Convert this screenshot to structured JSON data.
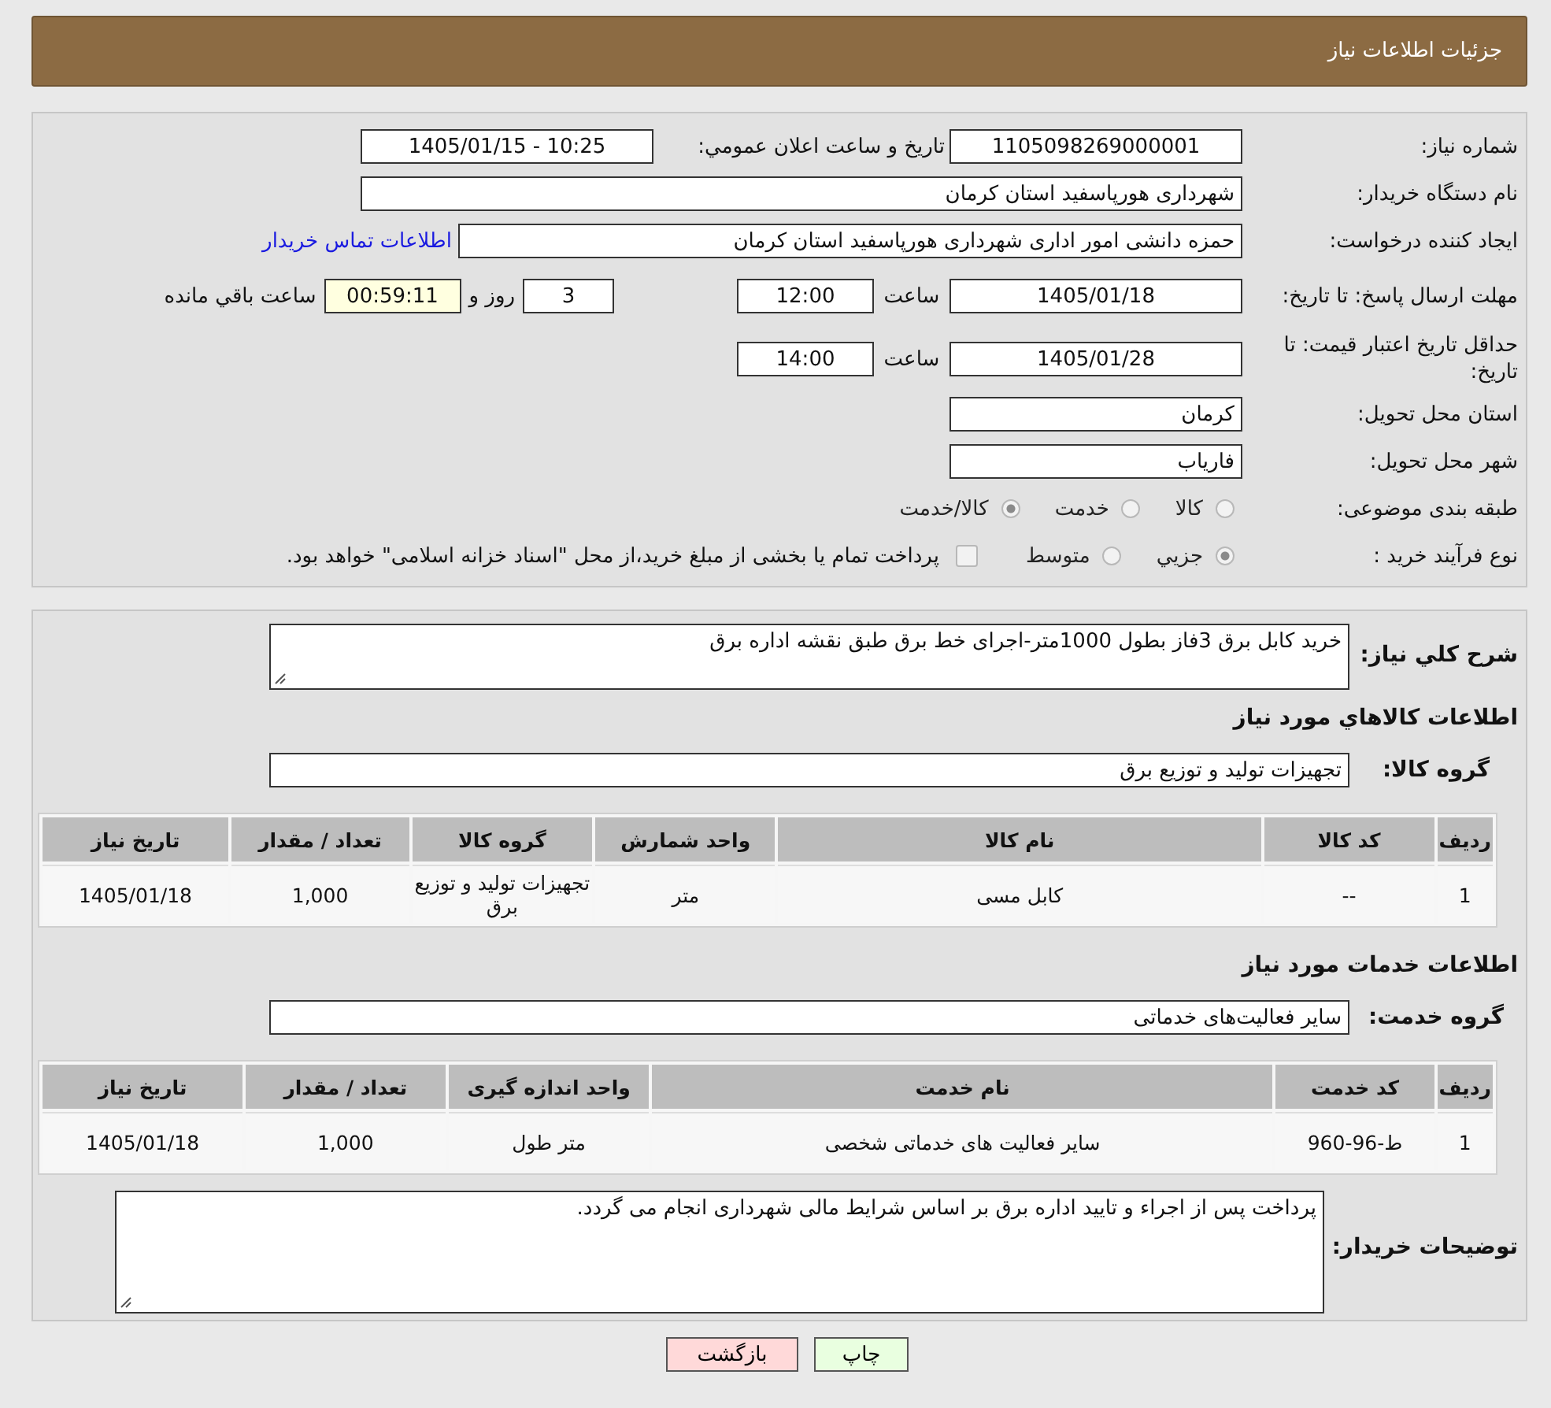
{
  "header": {
    "title": "جزئیات اطلاعات نیاز"
  },
  "details": {
    "need_number": {
      "label": "شماره نیاز:",
      "value": "1105098269000001"
    },
    "announce": {
      "label": "تاریخ و ساعت اعلان عمومي:",
      "value": "1405/01/15 - 10:25"
    },
    "buyer_org": {
      "label": "نام دستگاه خریدار:",
      "value": "شهرداری هورپاسفید استان کرمان"
    },
    "requester": {
      "label": "ایجاد کننده درخواست:",
      "value": "حمزه دانشی امور اداری شهرداری هورپاسفید استان کرمان",
      "link": "اطلاعات تماس خریدار"
    },
    "reply_deadline": {
      "label": "مهلت ارسال پاسخ: تا تاریخ:",
      "date": "1405/01/18",
      "time_label": "ساعت",
      "time": "12:00",
      "days": "3",
      "days_suffix": "روز و",
      "remaining": "00:59:11",
      "remaining_suffix": "ساعت باقي مانده"
    },
    "price_validity": {
      "label": "حداقل تاریخ اعتبار قیمت: تا تاریخ:",
      "date": "1405/01/28",
      "time_label": "ساعت",
      "time": "14:00"
    },
    "province": {
      "label": "استان محل تحویل:",
      "value": "کرمان"
    },
    "city": {
      "label": "شهر محل تحویل:",
      "value": "فاریاب"
    },
    "category": {
      "label": "طبقه بندی موضوعی:",
      "options": [
        {
          "label": "کالا",
          "selected": false
        },
        {
          "label": "خدمت",
          "selected": false
        },
        {
          "label": "کالا/خدمت",
          "selected": true
        }
      ]
    },
    "process": {
      "label": "نوع فرآیند خرید :",
      "options": [
        {
          "label": "جزيي",
          "selected": true
        },
        {
          "label": "متوسط",
          "selected": false
        }
      ],
      "treasury": {
        "label": "پرداخت تمام یا بخشی از مبلغ خرید،از محل \"اسناد خزانه اسلامی\" خواهد بود.",
        "checked": false
      }
    }
  },
  "description": {
    "label": "شرح کلي نیاز:",
    "value": "خرید  کابل برق 3فاز بطول 1000متر-اجرای خط برق طبق نقشه اداره برق"
  },
  "goods": {
    "title": "اطلاعات کالاهاي مورد نیاز",
    "group_label": "گروه کالا:",
    "group_value": "تجهیزات تولید و توزیع برق",
    "table": {
      "columns": [
        "ردیف",
        "کد کالا",
        "نام کالا",
        "واحد شمارش",
        "گروه کالا",
        "تعداد / مقدار",
        "تاریخ نیاز"
      ],
      "rows": [
        [
          "1",
          "--",
          "کابل مسی",
          "متر",
          "تجهیزات تولید و توزیع برق",
          "1,000",
          "1405/01/18"
        ]
      ]
    }
  },
  "services": {
    "title": "اطلاعات خدمات مورد نیاز",
    "group_label": "گروه خدمت:",
    "group_value": "سایر فعالیت‌های خدماتی",
    "table": {
      "columns": [
        "ردیف",
        "کد خدمت",
        "نام خدمت",
        "واحد اندازه گیری",
        "تعداد / مقدار",
        "تاریخ نیاز"
      ],
      "rows": [
        [
          "1",
          "ط-96-960",
          "سایر فعالیت های خدماتی شخصی",
          "متر طول",
          "1,000",
          "1405/01/18"
        ]
      ]
    }
  },
  "buyer_notes": {
    "label": "توضیحات خریدار:",
    "value": "پرداخت پس از اجراء و تایید اداره برق بر اساس شرایط مالی شهرداری انجام می گردد."
  },
  "buttons": [
    {
      "label": "چاپ",
      "kind": "print"
    },
    {
      "label": "بازگشت",
      "kind": "back"
    }
  ]
}
